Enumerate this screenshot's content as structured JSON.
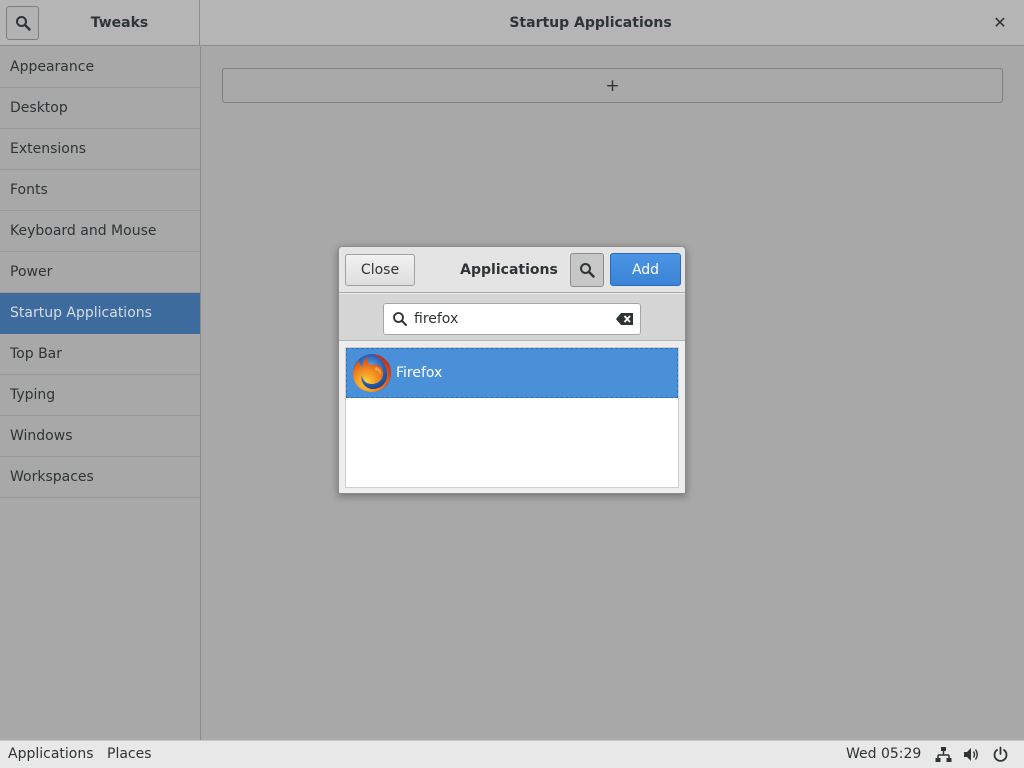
{
  "window": {
    "app_title": "Tweaks",
    "panel_title": "Startup Applications",
    "close_glyph": "✕",
    "search_icon": "search-icon"
  },
  "sidebar": {
    "items": [
      {
        "label": "Appearance"
      },
      {
        "label": "Desktop"
      },
      {
        "label": "Extensions"
      },
      {
        "label": "Fonts"
      },
      {
        "label": "Keyboard and Mouse"
      },
      {
        "label": "Power"
      },
      {
        "label": "Startup Applications",
        "selected": true
      },
      {
        "label": "Top Bar"
      },
      {
        "label": "Typing"
      },
      {
        "label": "Windows"
      },
      {
        "label": "Workspaces"
      }
    ]
  },
  "main": {
    "add_glyph": "+"
  },
  "dialog": {
    "close_label": "Close",
    "title": "Applications",
    "add_label": "Add",
    "search": {
      "value": "firefox"
    },
    "results": [
      {
        "label": "Firefox",
        "icon": "firefox-icon",
        "selected": true
      }
    ]
  },
  "panel": {
    "applications_label": "Applications",
    "places_label": "Places",
    "clock": "Wed 05:29",
    "tray_icons": [
      "network-icon",
      "volume-icon",
      "power-icon"
    ]
  },
  "colors": {
    "accent": "#4a90d9",
    "sidebar_selected": "#3e6b9e",
    "add_button": "#3b83d6"
  }
}
